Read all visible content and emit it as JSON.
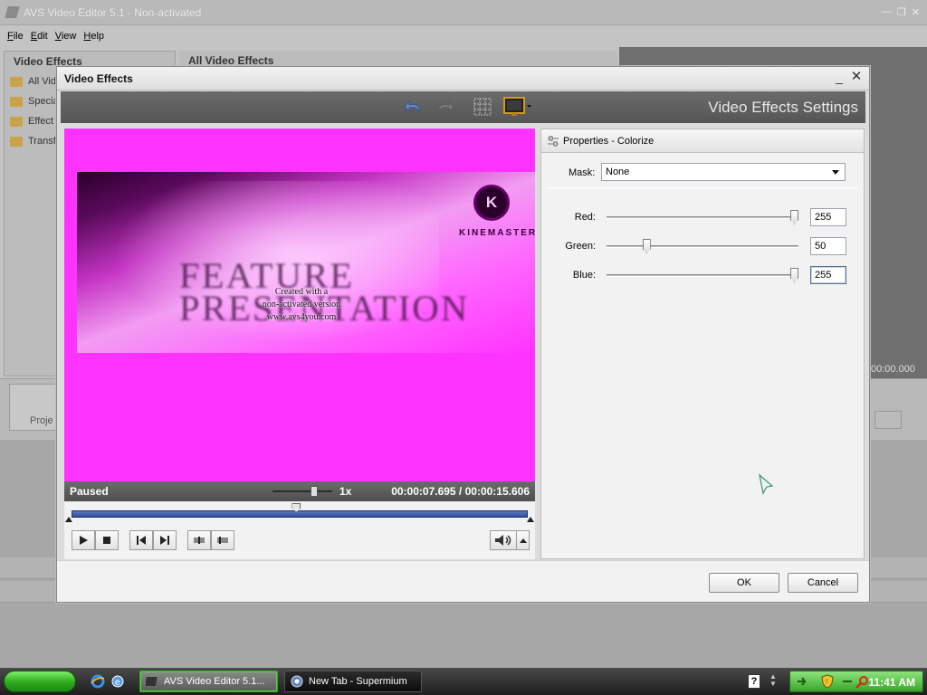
{
  "app": {
    "title": "AVS Video Editor 5.1 - Non-activated",
    "menu": [
      "File",
      "Edit",
      "View",
      "Help"
    ],
    "left_panel_title": "Video Effects",
    "left_items": [
      "All Vid",
      "Specia",
      "Effect",
      "Transf"
    ],
    "center_title": "All Video Effects",
    "right_time": "00:00.000",
    "project_label": "Proje"
  },
  "dialog": {
    "title": "Video Effects",
    "toolbar_title": "Video Effects Settings",
    "preview": {
      "logo_letter": "K",
      "logo_text": "KINEMASTER",
      "feature_line1": "FEATURE",
      "feature_line2": "PRESENTATION",
      "watermark_line1": "Created with a",
      "watermark_line2": "non-activated version",
      "watermark_line3": "www.avs4you.com",
      "tint_color": "#ff33ff"
    },
    "status": {
      "state": "Paused",
      "speed": "1x",
      "time": "00:00:07.695 / 00:00:15.606",
      "speed_position": 0.7,
      "seek_position": 0.493
    },
    "properties": {
      "header": "Properties - Colorize",
      "mask_label": "Mask:",
      "mask_value": "None",
      "sliders": [
        {
          "label": "Red:",
          "value": "255",
          "fraction": 1.0
        },
        {
          "label": "Green:",
          "value": "50",
          "fraction": 0.196
        },
        {
          "label": "Blue:",
          "value": "255",
          "fraction": 1.0
        }
      ]
    },
    "buttons": {
      "ok": "OK",
      "cancel": "Cancel"
    }
  },
  "taskbar": {
    "tasks": [
      {
        "label": "AVS Video Editor 5.1..."
      },
      {
        "label": "New Tab - Supermium"
      }
    ],
    "clock": "11:41 AM",
    "help_glyph": "?"
  },
  "colors": {
    "accent_seek": "#33509e",
    "start_green": "#2ea81b"
  }
}
